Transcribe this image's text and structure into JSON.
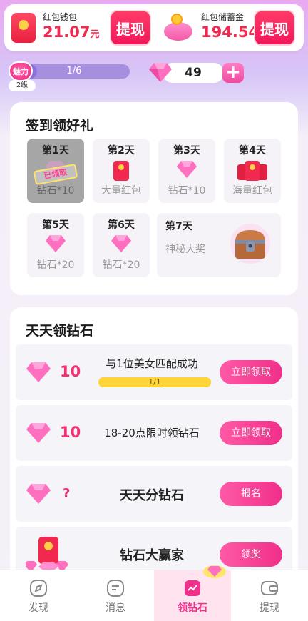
{
  "wallet": {
    "red_packet": {
      "label": "红包钱包",
      "amount": "21.07",
      "unit": "元",
      "button": "提现"
    },
    "savings": {
      "label": "红包储蓄金",
      "amount": "194.54",
      "unit": "元",
      "button": "提现"
    }
  },
  "charm": {
    "badge": "魅力",
    "progress_text": "1/6",
    "progress_fraction": 0.1667,
    "level": "2级"
  },
  "diamonds": {
    "count": "49",
    "add": "+"
  },
  "signin": {
    "title": "签到领好礼",
    "days": [
      {
        "label": "第1天",
        "reward": "钻石*10",
        "status": "已领取"
      },
      {
        "label": "第2天",
        "reward": "大量红包"
      },
      {
        "label": "第3天",
        "reward": "钻石*10"
      },
      {
        "label": "第4天",
        "reward": "海量红包"
      },
      {
        "label": "第5天",
        "reward": "钻石*20"
      },
      {
        "label": "第6天",
        "reward": "钻石*20"
      },
      {
        "label": "第7天",
        "reward": "神秘大奖"
      }
    ]
  },
  "daily": {
    "title": "天天领钻石",
    "tasks": [
      {
        "count": "10",
        "title": "与1位美女匹配成功",
        "progress": "1/1",
        "progress_fraction": 1.0,
        "button": "立即领取"
      },
      {
        "count": "10",
        "title": "18-20点限时领钻石",
        "button": "立即领取"
      },
      {
        "count": "?",
        "title": "天天分钻石",
        "button": "报名"
      },
      {
        "title": "钻石大赢家",
        "button": "领奖"
      }
    ]
  },
  "nav": {
    "items": [
      {
        "label": "发现",
        "icon": "compass-icon"
      },
      {
        "label": "消息",
        "icon": "message-icon"
      },
      {
        "label": "领钻石",
        "icon": "diamond-tab-icon",
        "active": true
      },
      {
        "label": "提现",
        "icon": "wallet-icon"
      }
    ]
  },
  "colors": {
    "accent": "#f0308a",
    "red": "#f2294f",
    "purple": "#a78fe0"
  }
}
